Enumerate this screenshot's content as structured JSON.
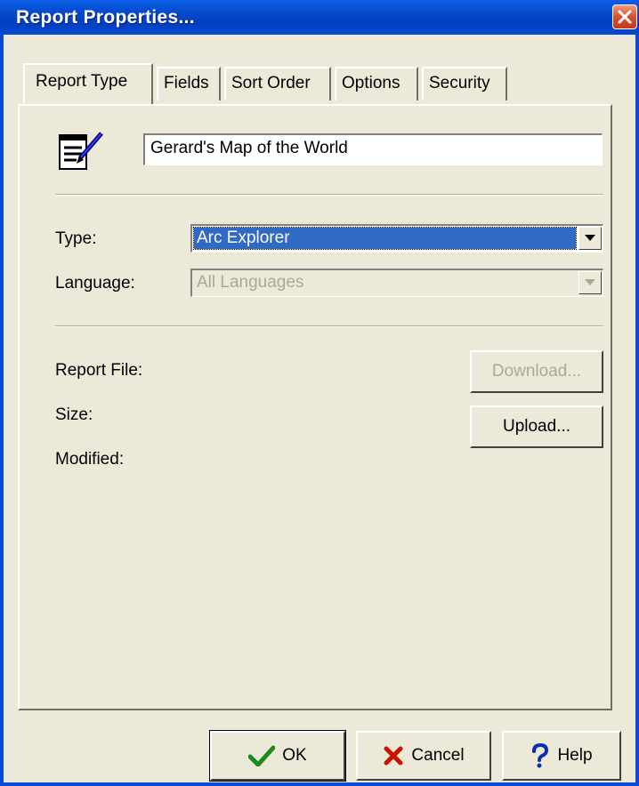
{
  "window": {
    "title": "Report Properties..."
  },
  "tabs": [
    {
      "label": "Report Type",
      "active": true
    },
    {
      "label": "Fields",
      "active": false
    },
    {
      "label": "Sort Order",
      "active": false
    },
    {
      "label": "Options",
      "active": false
    },
    {
      "label": "Security",
      "active": false
    }
  ],
  "report": {
    "icon": "notepad-pencil-icon",
    "name": "Gerard's Map of the World"
  },
  "type": {
    "label": "Type:",
    "value": "Arc Explorer"
  },
  "language": {
    "label": "Language:",
    "value": "All Languages",
    "disabled": true
  },
  "file": {
    "report_file_label": "Report File:",
    "size_label": "Size:",
    "modified_label": "Modified:",
    "download_label": "Download...",
    "upload_label": "Upload..."
  },
  "footer": {
    "ok_label": "OK",
    "cancel_label": "Cancel",
    "help_label": "Help"
  },
  "colors": {
    "titlebar": "#0a4bd6",
    "selection": "#316ac5",
    "dialog_bg": "#ece9d8",
    "disabled_text": "#aca899"
  }
}
